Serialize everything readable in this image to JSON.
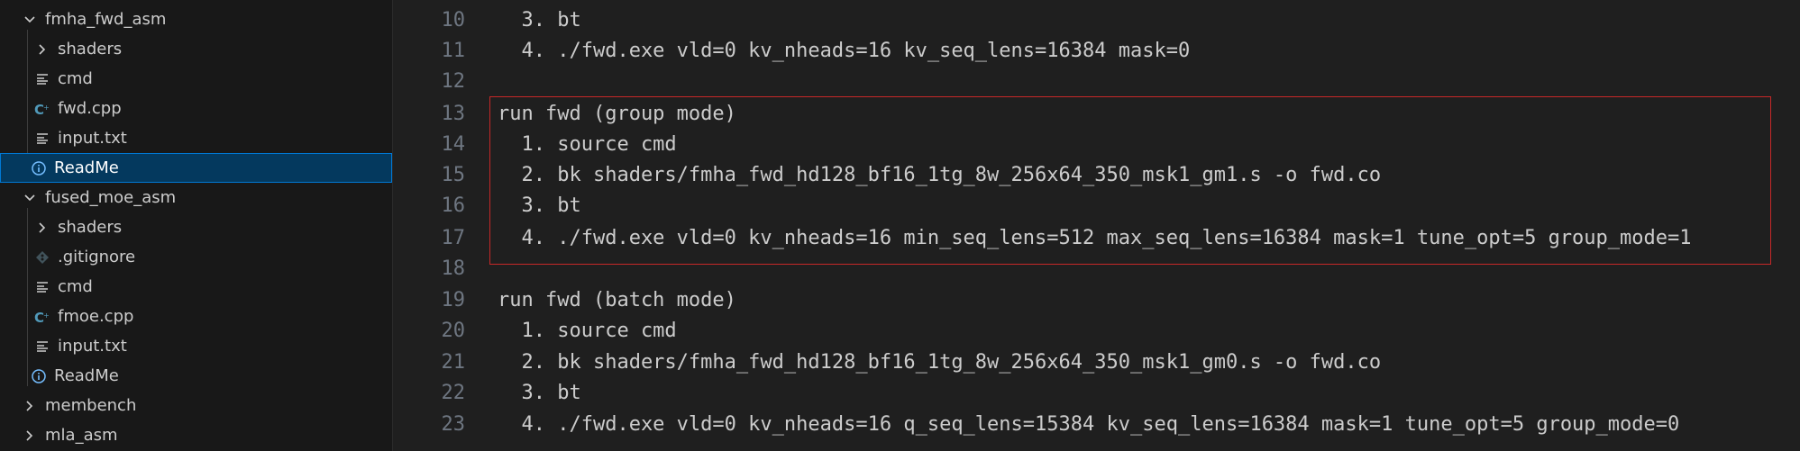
{
  "explorer": {
    "items": [
      {
        "label": "fmha_fwd_asm",
        "kind": "folder-open",
        "depth": 1
      },
      {
        "label": "shaders",
        "kind": "folder-closed",
        "depth": 2
      },
      {
        "label": "cmd",
        "kind": "text-file",
        "depth": 2
      },
      {
        "label": "fwd.cpp",
        "kind": "cpp-file",
        "depth": 2
      },
      {
        "label": "input.txt",
        "kind": "text-file",
        "depth": 2
      },
      {
        "label": "ReadMe",
        "kind": "info-file",
        "depth": 2,
        "selected": true
      },
      {
        "label": "fused_moe_asm",
        "kind": "folder-open",
        "depth": 1
      },
      {
        "label": "shaders",
        "kind": "folder-closed",
        "depth": 2
      },
      {
        "label": ".gitignore",
        "kind": "git-file",
        "depth": 2
      },
      {
        "label": "cmd",
        "kind": "text-file",
        "depth": 2
      },
      {
        "label": "fmoe.cpp",
        "kind": "cpp-file",
        "depth": 2
      },
      {
        "label": "input.txt",
        "kind": "text-file",
        "depth": 2
      },
      {
        "label": "ReadMe",
        "kind": "info-file",
        "depth": 2
      },
      {
        "label": "membench",
        "kind": "folder-closed",
        "depth": 1
      },
      {
        "label": "mla_asm",
        "kind": "folder-closed",
        "depth": 1
      }
    ]
  },
  "editor": {
    "lines": [
      {
        "num": "10",
        "text": "  3. bt"
      },
      {
        "num": "11",
        "text": "  4. ./fwd.exe vld=0 kv_nheads=16 kv_seq_lens=16384 mask=0"
      },
      {
        "num": "12",
        "text": ""
      },
      {
        "num": "13",
        "text": "run fwd (group mode)"
      },
      {
        "num": "14",
        "text": "  1. source cmd"
      },
      {
        "num": "15",
        "text": "  2. bk shaders/fmha_fwd_hd128_bf16_1tg_8w_256x64_350_msk1_gm1.s -o fwd.co"
      },
      {
        "num": "16",
        "text": "  3. bt"
      },
      {
        "num": "17",
        "text": "  4. ./fwd.exe vld=0 kv_nheads=16 min_seq_lens=512 max_seq_lens=16384 mask=1 tune_opt=5 group_mode=1"
      },
      {
        "num": "18",
        "text": ""
      },
      {
        "num": "19",
        "text": "run fwd (batch mode)"
      },
      {
        "num": "20",
        "text": "  1. source cmd"
      },
      {
        "num": "21",
        "text": "  2. bk shaders/fmha_fwd_hd128_bf16_1tg_8w_256x64_350_msk1_gm0.s -o fwd.co"
      },
      {
        "num": "22",
        "text": "  3. bt"
      },
      {
        "num": "23",
        "text": "  4. ./fwd.exe vld=0 kv_nheads=16 q_seq_lens=15384 kv_seq_lens=16384 mask=1 tune_opt=5 group_mode=0"
      }
    ]
  },
  "colors": {
    "highlight_box": "#c62828",
    "selection": "#04395e",
    "cpp_icon": "#519aba",
    "info_icon": "#75beff"
  }
}
